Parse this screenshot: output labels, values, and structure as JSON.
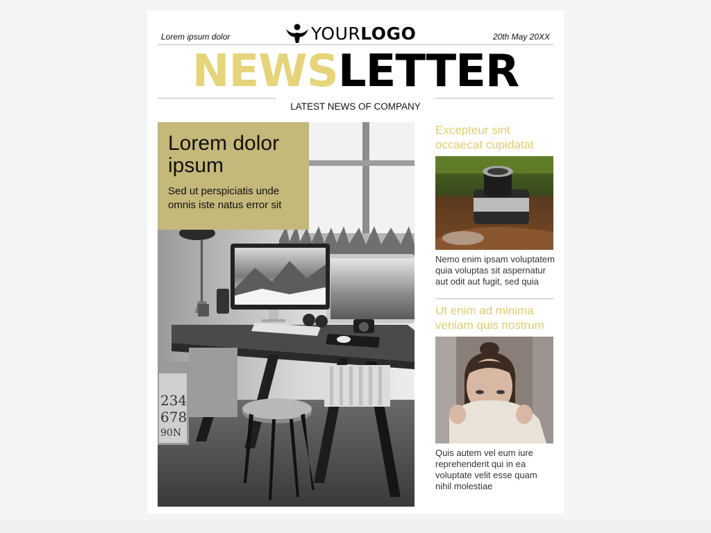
{
  "header": {
    "left_text": "Lorem ipsum dolor",
    "date": "20th May 20XX",
    "logo_light": "YOUR",
    "logo_bold": "LOGO"
  },
  "masthead": {
    "part1": "NEWS",
    "part2": "LETTER",
    "tagline": "LATEST NEWS OF COMPANY"
  },
  "feature": {
    "title": "Lorem dolor ipsum",
    "subtitle": "Sed ut perspiciatis  unde omnis iste natus error sit"
  },
  "sidebar": {
    "articles": [
      {
        "title": "Excepteur sint occaecat cupidatat",
        "body": "Nemo enim ipsam voluptatem quia voluptas sit aspernatur aut odit aut fugit, sed quia"
      },
      {
        "title": "Ut enim ad minima veniam quis nostrum",
        "body": "Quis autem vel eum iure reprehenderit qui in ea voluptate velit esse quam nihil molestiae"
      }
    ]
  },
  "colors": {
    "accent": "#e5d47a",
    "feature_box": "#c4b87a",
    "sidebar_heading": "#e0cd72",
    "page_bg": "#f4f4f4"
  },
  "images": {
    "hero": "desk-workspace-photo",
    "article1": "camera-on-wood-photo",
    "article2": "woman-in-sweater-photo"
  }
}
